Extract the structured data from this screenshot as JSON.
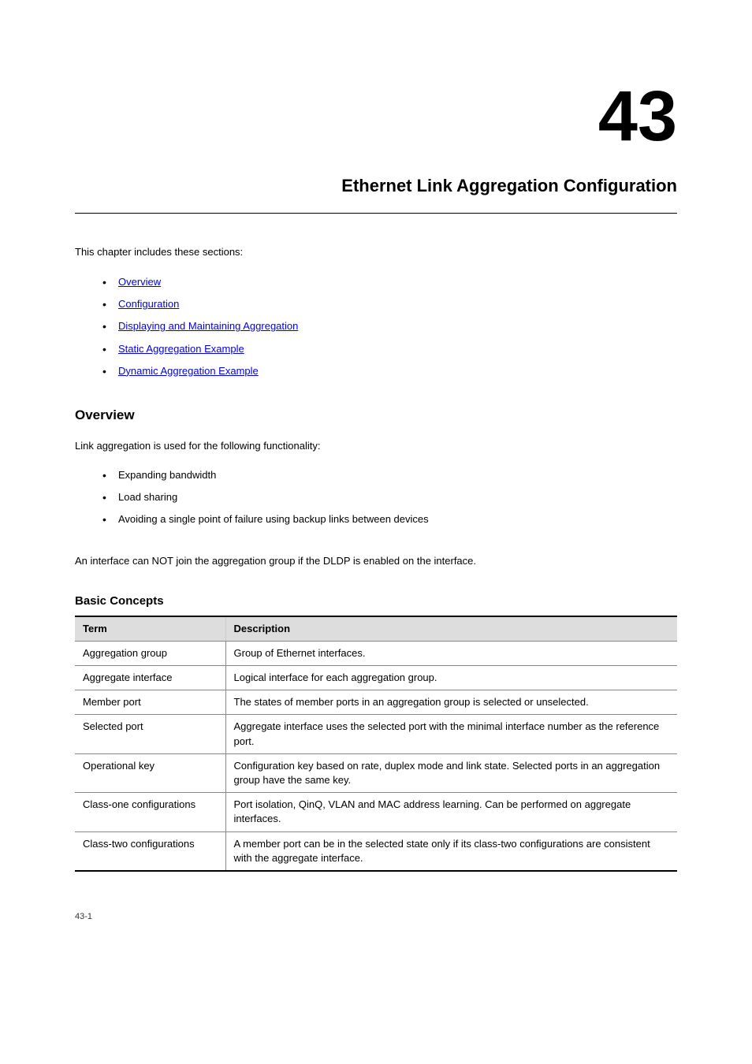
{
  "chapter": {
    "number": "43",
    "title": "Ethernet Link Aggregation Configuration"
  },
  "toc": {
    "intro": "This chapter includes these sections:",
    "items": [
      "Overview",
      "Configuration",
      "Displaying and Maintaining Aggregation",
      "Static Aggregation Example",
      "Dynamic Aggregation Example"
    ]
  },
  "section": {
    "heading": "Overview",
    "para": "Link aggregation is used for the following functionality:",
    "bullets": [
      "Expanding bandwidth",
      "Load sharing",
      "Avoiding a single point of failure using backup links between devices"
    ],
    "note": "An interface can NOT join the aggregation group if the DLDP is enabled on the interface."
  },
  "table": {
    "title": "Basic Concepts",
    "headers": [
      "Term",
      "Description"
    ],
    "rows": [
      {
        "term": "Aggregation group",
        "desc": "Group of Ethernet interfaces."
      },
      {
        "term": "Aggregate interface",
        "desc": "Logical interface for each aggregation group."
      },
      {
        "term": "Member port",
        "desc": "The states of member ports in an aggregation group is selected or unselected."
      },
      {
        "term": "Selected port",
        "desc": "Aggregate interface uses the selected port with the minimal interface number as the reference port."
      },
      {
        "term": "Operational key",
        "desc": "Configuration key based on rate, duplex mode and link state. Selected ports in an aggregation group have the same key."
      },
      {
        "term": "Class-one configurations",
        "desc": "Port isolation, QinQ, VLAN and MAC address learning. Can be performed on aggregate interfaces."
      },
      {
        "term": "Class-two configurations",
        "desc": "A member port can be in the selected state only if its class-two configurations are consistent with the aggregate interface."
      }
    ]
  },
  "footer": "43-1"
}
